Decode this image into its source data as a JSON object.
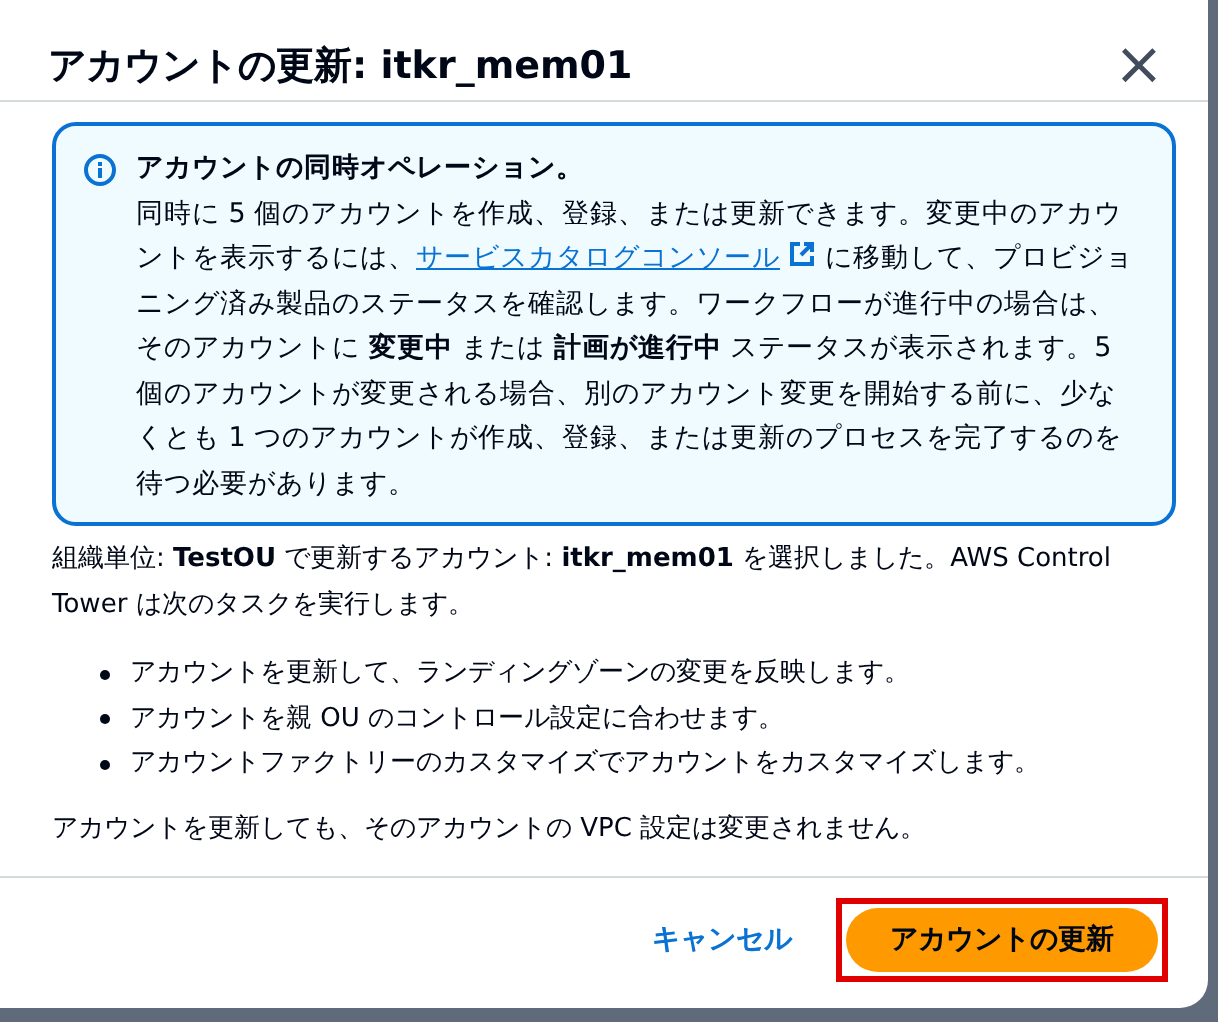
{
  "dialog": {
    "title": "アカウントの更新: itkr_mem01",
    "close": "×"
  },
  "alert": {
    "heading": "アカウントの同時オペレーション。",
    "text_before": "同時に 5 個のアカウントを作成、登録、または更新できます。変更中のアカウントを表示するには、",
    "link": "サービスカタログコンソール",
    "text_after": " に移動して、プロビジョニング済み製品のステータスを確認します。ワークフローが進行中の場合は、そのアカウントに **変更中** または **計画が進行中** ステータスが表示されます。5 個のアカウントが変更される場合、別のアカウント変更を開始する前に、少なくとも 1 つのアカウントが作成、登録、または更新のプロセスを完了するのを待つ必要があります。"
  },
  "intro": "組織単位: **TestOU** で更新するアカウント: **itkr_mem01** を選択しました。AWS Control Tower は次のタスクを実行します。",
  "tasks": [
    "アカウントを更新して、ランディングゾーンの変更を反映します。",
    "アカウントを親 OU のコントロール設定に合わせます。",
    "アカウントファクトリーのカスタマイズでアカウントをカスタマイズします。"
  ],
  "note": "アカウントを更新しても、そのアカウントの VPC 設定は変更されません。",
  "buttons": [
    {
      "label": "キャンセル",
      "kind": "link",
      "highlighted": false
    },
    {
      "label": "アカウントの更新",
      "kind": "primary",
      "highlighted": true
    }
  ]
}
